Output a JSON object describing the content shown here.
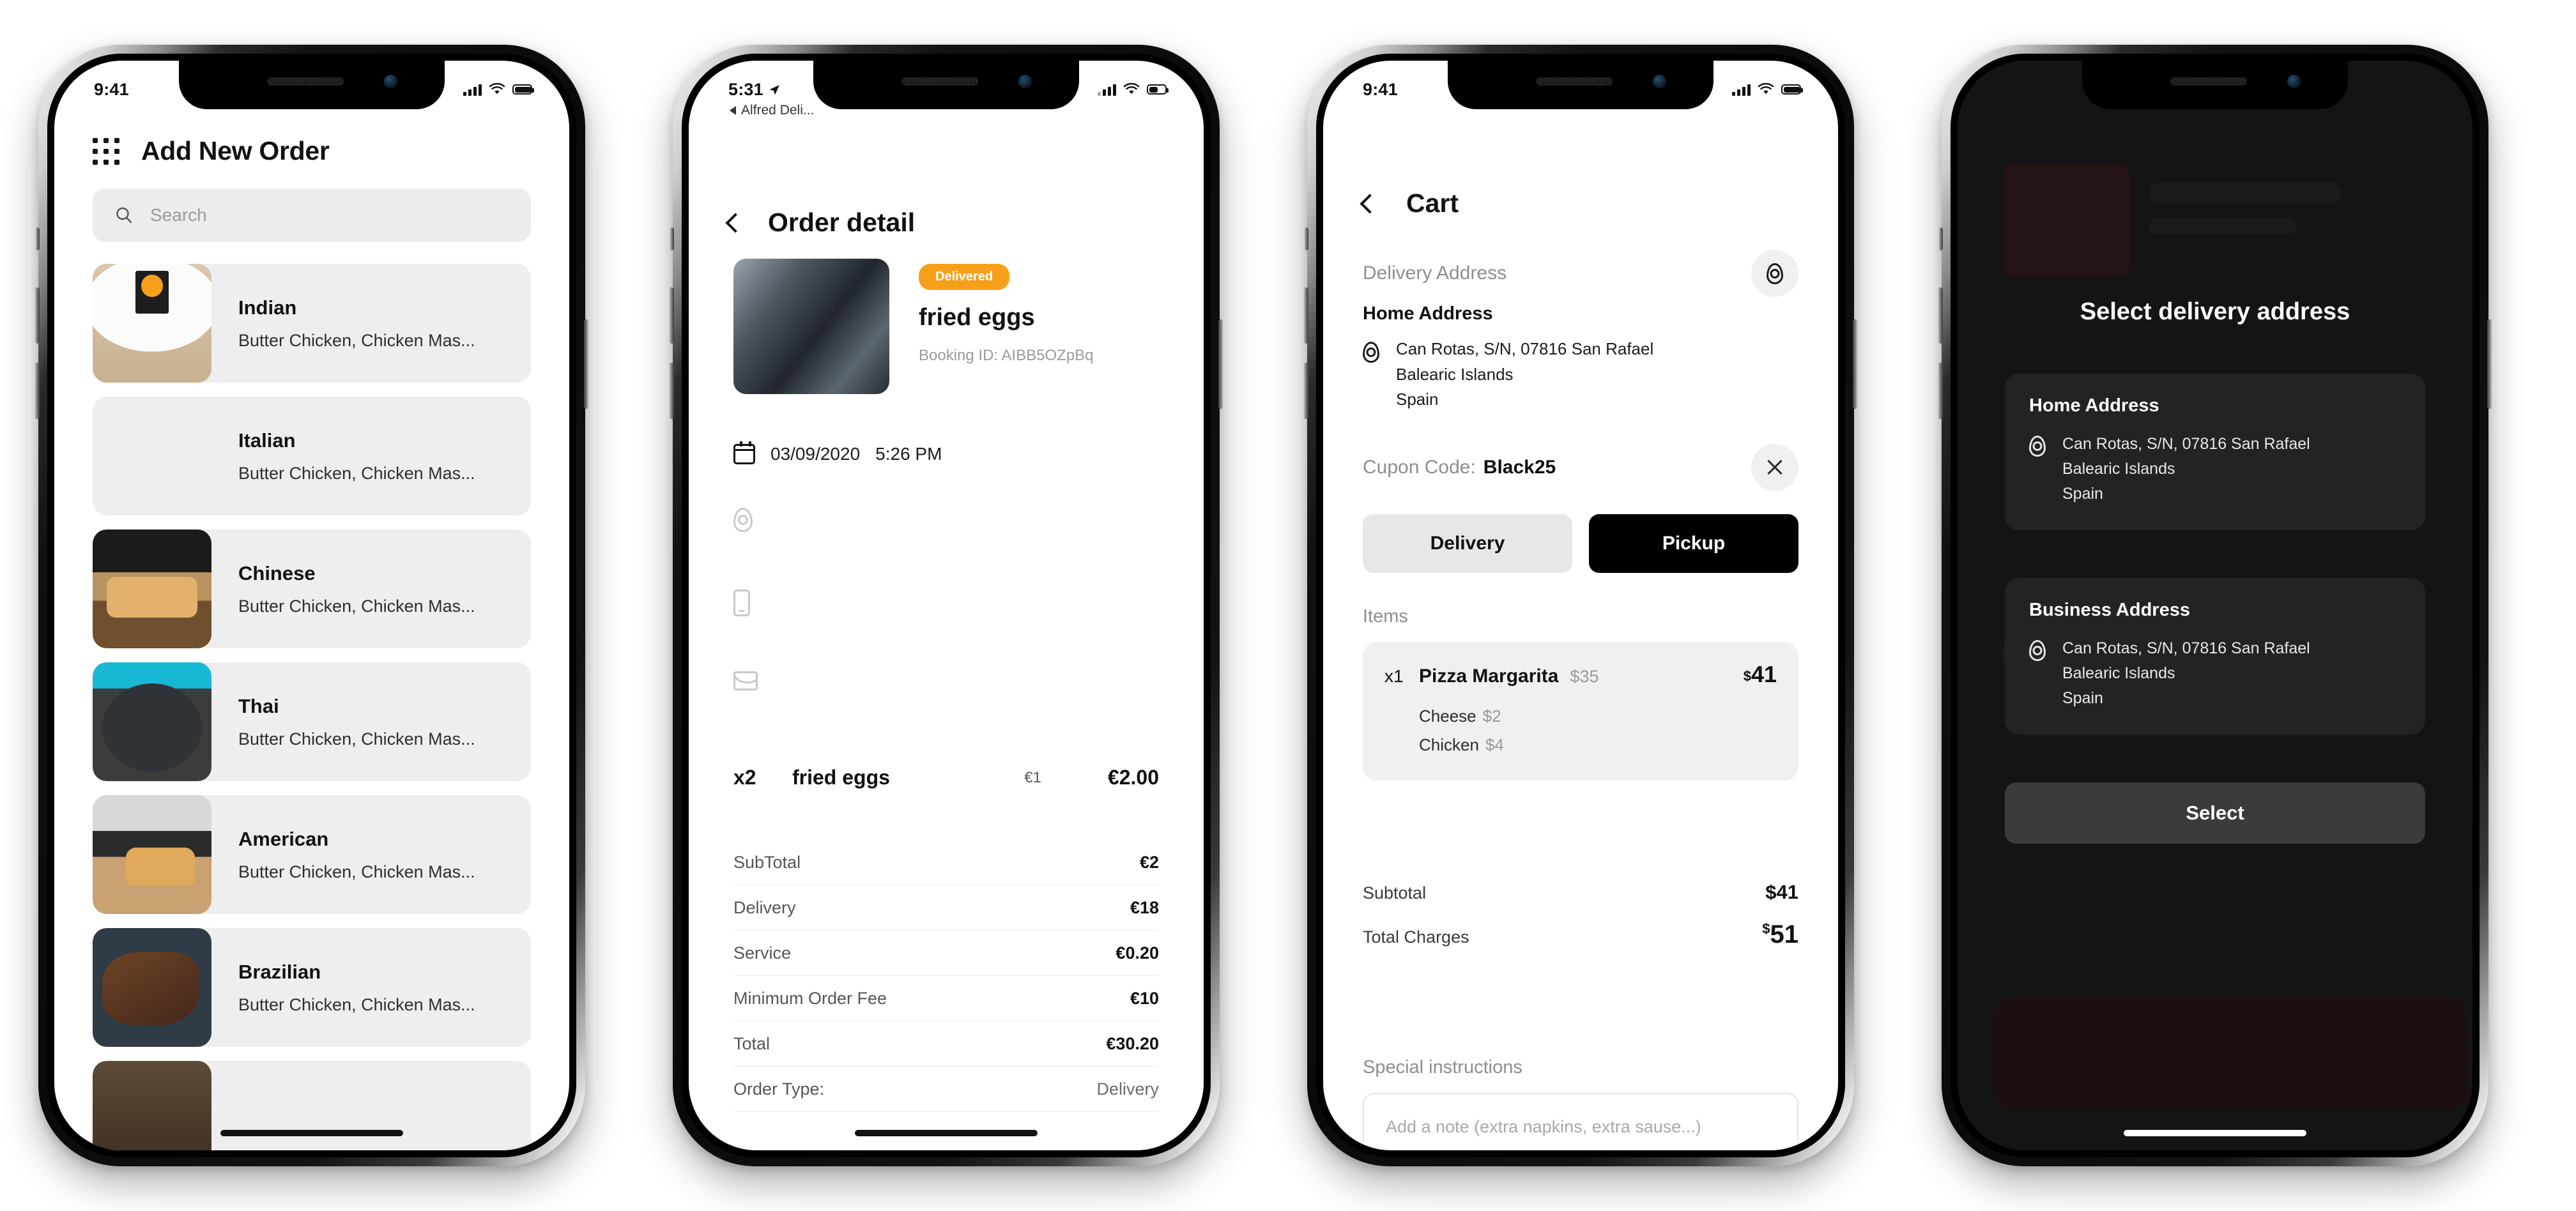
{
  "screens": [
    {
      "id": "add-new-order",
      "status": {
        "time": "9:41"
      },
      "title": "Add New Order",
      "search": {
        "placeholder": "Search"
      },
      "list": [
        {
          "name": "Indian",
          "desc": "Butter Chicken, Chicken Mas..."
        },
        {
          "name": "Italian",
          "desc": "Butter Chicken, Chicken Mas..."
        },
        {
          "name": "Chinese",
          "desc": "Butter Chicken, Chicken Mas..."
        },
        {
          "name": "Thai",
          "desc": "Butter Chicken, Chicken Mas..."
        },
        {
          "name": "American",
          "desc": "Butter Chicken, Chicken Mas..."
        },
        {
          "name": "Brazilian",
          "desc": "Butter Chicken, Chicken Mas..."
        }
      ]
    },
    {
      "id": "order-detail",
      "status": {
        "time": "5:31",
        "back_app": "Alfred Deli..."
      },
      "title": "Order detail",
      "badge": "Delivered",
      "order_name": "fried eggs",
      "booking_id": "Booking ID: AIBB5OZpBq",
      "date": "03/09/2020",
      "time": "5:26 PM",
      "line_item": {
        "qty": "x2",
        "name": "fried eggs",
        "unit": "€1",
        "amount": "€2.00"
      },
      "fees": [
        {
          "label": "SubTotal",
          "value": "€2",
          "muted": false
        },
        {
          "label": "Delivery",
          "value": "€18",
          "muted": false
        },
        {
          "label": "Service",
          "value": "€0.20",
          "muted": false
        },
        {
          "label": "Minimum Order Fee",
          "value": "€10",
          "muted": false
        },
        {
          "label": "Total",
          "value": "€30.20",
          "muted": false
        },
        {
          "label": "Order Type:",
          "value": "Delivery",
          "muted": true
        }
      ]
    },
    {
      "id": "cart",
      "status": {
        "time": "9:41"
      },
      "title": "Cart",
      "delivery_address_label": "Delivery Address",
      "home_address_label": "Home Address",
      "address_lines": [
        "Can Rotas, S/N, 07816 San Rafael",
        "Balearic Islands",
        "Spain"
      ],
      "coupon_label": "Cupon Code:",
      "coupon_value": "Black25",
      "toggle": {
        "delivery": "Delivery",
        "pickup": "Pickup",
        "selected": "Pickup"
      },
      "items_label": "Items",
      "item": {
        "qty": "x1",
        "name": "Pizza Margarita",
        "base_price": "$35",
        "total_price": "41",
        "total_currency": "$",
        "options": [
          {
            "name": "Cheese",
            "price": "$2"
          },
          {
            "name": "Chicken",
            "price": "$4"
          }
        ]
      },
      "totals": [
        {
          "label": "Subtotal",
          "value": "$41",
          "currency": "",
          "big": false
        },
        {
          "label": "Total Charges",
          "value": "51",
          "currency": "$",
          "big": true
        }
      ],
      "special_label": "Special instructions",
      "special_placeholder": "Add a note (extra napkins, extra sause...)"
    },
    {
      "id": "select-delivery-address",
      "title": "Select delivery address",
      "cards": [
        {
          "title": "Home Address",
          "lines": [
            "Can Rotas, S/N, 07816 San Rafael",
            "Balearic Islands",
            "Spain"
          ]
        },
        {
          "title": "Business Address",
          "lines": [
            "Can Rotas, S/N, 07816 San Rafael",
            "Balearic Islands",
            "Spain"
          ]
        }
      ],
      "select_button": "Select"
    }
  ],
  "colors": {
    "accent": "#f6a01a",
    "dark": "#000000",
    "muted": "#8e8e8e",
    "panel": "#f0f0f0"
  }
}
